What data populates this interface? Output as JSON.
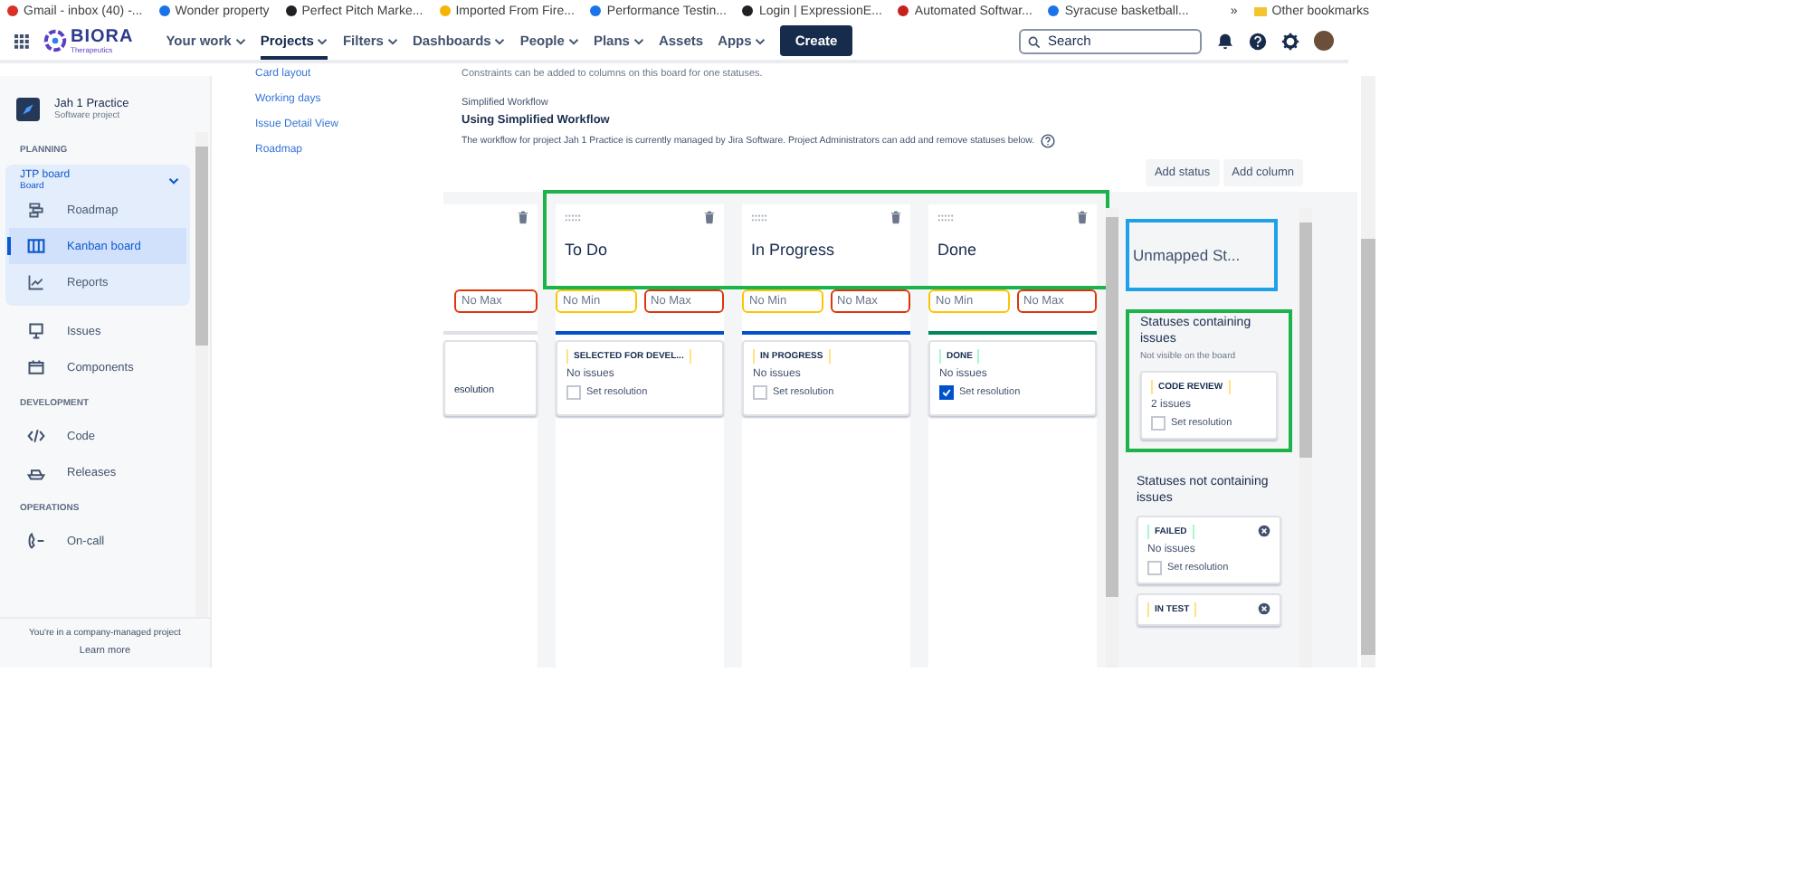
{
  "bookmarks": [
    {
      "label": "Gmail - inbox (40) -...",
      "color": "#d93025"
    },
    {
      "label": "Wonder property",
      "color": "#1a73e8"
    },
    {
      "label": "Perfect Pitch Marke...",
      "color": "#202124"
    },
    {
      "label": "Imported From Fire...",
      "color": "#f4b400"
    },
    {
      "label": "Performance Testin...",
      "color": "#1a73e8"
    },
    {
      "label": "Login | ExpressionE...",
      "color": "#202124"
    },
    {
      "label": "Automated Softwar...",
      "color": "#c5221f"
    },
    {
      "label": "Syracuse basketball...",
      "color": "#1a73e8"
    }
  ],
  "bookmarks_more": "»",
  "other_bookmarks": "Other bookmarks",
  "nav": {
    "logo": "BIORA",
    "logo_sub": "Therapeutics",
    "menus": [
      {
        "label": "Your work",
        "dropdown": true,
        "selected": false
      },
      {
        "label": "Projects",
        "dropdown": true,
        "selected": true
      },
      {
        "label": "Filters",
        "dropdown": true,
        "selected": false
      },
      {
        "label": "Dashboards",
        "dropdown": true,
        "selected": false
      },
      {
        "label": "People",
        "dropdown": true,
        "selected": false
      },
      {
        "label": "Plans",
        "dropdown": true,
        "selected": false
      },
      {
        "label": "Assets",
        "dropdown": false,
        "selected": false
      },
      {
        "label": "Apps",
        "dropdown": true,
        "selected": false
      }
    ],
    "create": "Create",
    "search": {
      "placeholder": "Search"
    }
  },
  "sidebar": {
    "project": "Jah 1 Practice",
    "project_type": "Software project",
    "sections": [
      {
        "heading": "PLANNING",
        "board": {
          "title": "JTP board",
          "subtitle": "Board",
          "expanded": true,
          "items": [
            {
              "label": "Roadmap",
              "selected": false
            },
            {
              "label": "Kanban board",
              "selected": true
            },
            {
              "label": "Reports",
              "selected": false
            }
          ]
        },
        "items": [
          {
            "label": "Issues",
            "selected": false
          },
          {
            "label": "Components",
            "selected": false
          }
        ]
      },
      {
        "heading": "DEVELOPMENT",
        "items": [
          {
            "label": "Code",
            "selected": false
          },
          {
            "label": "Releases",
            "selected": false
          }
        ]
      },
      {
        "heading": "OPERATIONS",
        "items": [
          {
            "label": "On-call",
            "selected": false
          }
        ]
      }
    ],
    "footer": "You're in a company-managed project",
    "learn_more": "Learn more"
  },
  "settings_nav": [
    "Card layout",
    "Working days",
    "Issue Detail View",
    "Roadmap"
  ],
  "main": {
    "top_note": "Constraints can be added to columns on this board for one statuses.",
    "section_label": "Simplified Workflow",
    "heading": "Using Simplified Workflow",
    "description": "The workflow for project Jah 1 Practice is currently managed by Jira Software. Project Administrators can add and remove statuses below.",
    "buttons": [
      "Add status",
      "Add column"
    ]
  },
  "columns": [
    {
      "kind": "partial",
      "max": "No Max",
      "color": "#dfe1e6",
      "card": {
        "resolution": "esolution"
      }
    },
    {
      "kind": "full",
      "name": "To Do",
      "min": "No Min",
      "max": "No Max",
      "color": "#0052cc",
      "card": {
        "status": "SELECTED FOR DEVEL...",
        "color": "#ffe380",
        "issues": "No issues",
        "resolution": "Set resolution",
        "checked": false
      }
    },
    {
      "kind": "full",
      "name": "In Progress",
      "min": "No Min",
      "max": "No Max",
      "color": "#0052cc",
      "card": {
        "status": "IN PROGRESS",
        "color": "#ffe380",
        "issues": "No issues",
        "resolution": "Set resolution",
        "checked": false
      }
    },
    {
      "kind": "full",
      "name": "Done",
      "min": "No Min",
      "max": "No Max",
      "color": "#00875a",
      "card": {
        "status": "DONE",
        "color": "#abf5d1",
        "issues": "No issues",
        "resolution": "Set resolution",
        "checked": true
      }
    }
  ],
  "unmapped": {
    "title": "Unmapped St...",
    "containing": {
      "heading": "Statuses containing issues",
      "subtext": "Not visible on the board",
      "cards": [
        {
          "status": "CODE REVIEW",
          "color": "#ffe380",
          "issues": "2 issues",
          "resolution": "Set resolution",
          "checked": false
        }
      ]
    },
    "not_containing": {
      "heading": "Statuses not containing issues",
      "cards": [
        {
          "status": "FAILED",
          "color": "#abf5d1",
          "issues": "No issues",
          "resolution": "Set resolution",
          "checked": false
        },
        {
          "status": "IN TEST",
          "color": "#ffe380"
        }
      ]
    }
  }
}
